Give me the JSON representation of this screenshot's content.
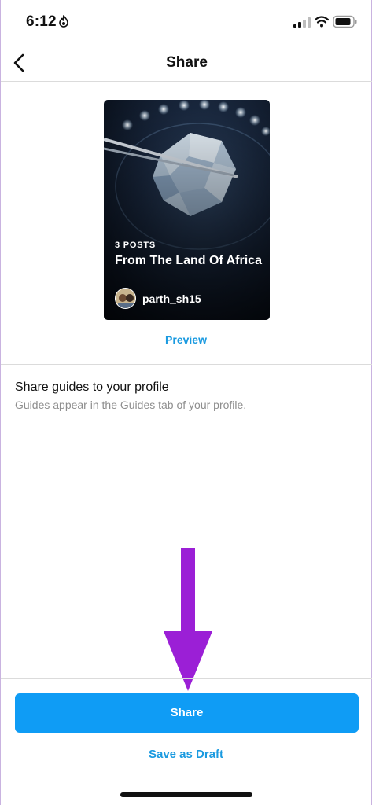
{
  "status_bar": {
    "time": "6:12"
  },
  "nav": {
    "title": "Share"
  },
  "guide_card": {
    "post_count": "3 POSTS",
    "title": "From The Land Of Africa",
    "username": "parth_sh15"
  },
  "preview_label": "Preview",
  "share_option": {
    "heading": "Share guides to your profile",
    "subtext": "Guides appear in the Guides tab of your profile."
  },
  "footer": {
    "share_label": "Share",
    "draft_label": "Save as Draft"
  },
  "colors": {
    "accent": "#0f9cf5",
    "link": "#1a9ae0",
    "arrow": "#9b1fd6"
  }
}
